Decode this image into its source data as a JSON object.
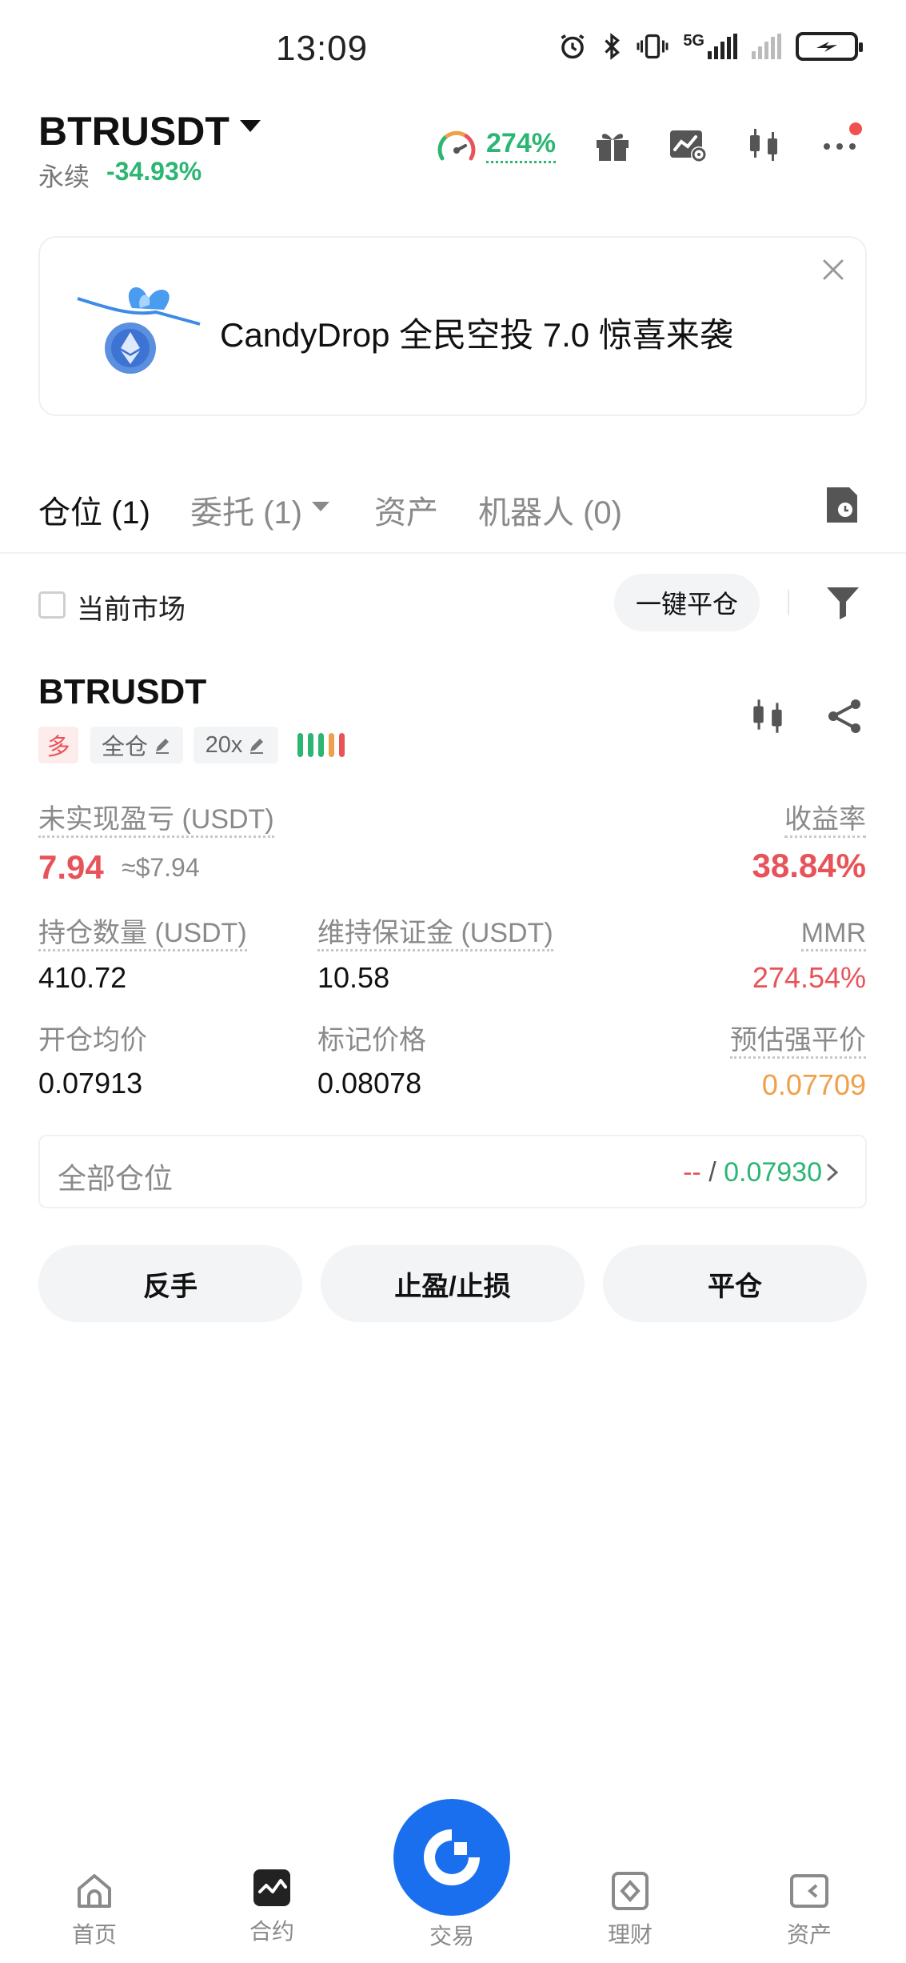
{
  "status_bar": {
    "time": "13:09",
    "network_label": "5G"
  },
  "header": {
    "pair": "BTRUSDT",
    "contract_type": "永续",
    "change_pct": "-34.93%",
    "risk_gauge_pct": "274%"
  },
  "banner": {
    "text": "CandyDrop 全民空投 7.0 惊喜来袭"
  },
  "tabs": [
    {
      "label": "仓位 (1)",
      "active": true
    },
    {
      "label": "委托 (1)",
      "active": false
    },
    {
      "label": "资产",
      "active": false
    },
    {
      "label": "机器人 (0)",
      "active": false
    }
  ],
  "filter": {
    "current_market_label": "当前市场",
    "close_all_label": "一键平仓"
  },
  "position": {
    "symbol": "BTRUSDT",
    "side": "多",
    "margin_mode": "全仓",
    "leverage": "20x",
    "unrealized_pnl_label": "未实现盈亏 (USDT)",
    "unrealized_pnl": "7.94",
    "unrealized_pnl_usd": "≈$7.94",
    "roe_label": "收益率",
    "roe": "38.84%",
    "size_label": "持仓数量 (USDT)",
    "size": "410.72",
    "maint_margin_label": "维持保证金 (USDT)",
    "maint_margin": "10.58",
    "mmr_label": "MMR",
    "mmr": "274.54%",
    "entry_label": "开仓均价",
    "entry": "0.07913",
    "mark_label": "标记价格",
    "mark": "0.08078",
    "liq_label": "预估强平价",
    "liq": "0.07709"
  },
  "summary": {
    "label": "全部仓位",
    "left_value": "--",
    "separator": "/",
    "right_value": "0.07930"
  },
  "actions": {
    "reverse": "反手",
    "tp_sl": "止盈/止损",
    "close": "平仓"
  },
  "bottom_nav": [
    {
      "label": "首页",
      "icon": "home-icon"
    },
    {
      "label": "合约",
      "icon": "futures-icon"
    },
    {
      "label": "交易",
      "icon": "trade-icon"
    },
    {
      "label": "理财",
      "icon": "earn-icon"
    },
    {
      "label": "资产",
      "icon": "wallet-icon"
    }
  ],
  "colors": {
    "up": "#2bb673",
    "down": "#e8535a",
    "warning": "#f0a04b",
    "brand": "#1a6fef"
  }
}
